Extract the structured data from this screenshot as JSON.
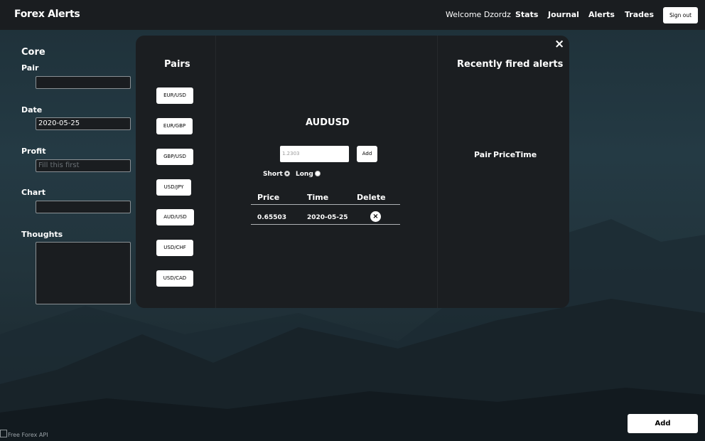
{
  "nav": {
    "brand": "Forex Alerts",
    "welcome": "Welcome Dzordz",
    "links": [
      "Stats",
      "Journal",
      "Alerts",
      "Trades"
    ],
    "signout": "Sign out"
  },
  "form": {
    "title": "Core",
    "pair_label": "Pair",
    "pair_value": "",
    "date_label": "Date",
    "date_value": "2020-05-25",
    "profit_label": "Profit",
    "profit_placeholder": "Fill this first",
    "chart_label": "Chart",
    "chart_value": "",
    "thoughts_label": "Thoughts",
    "thoughts_value": ""
  },
  "modal": {
    "close_icon": "×",
    "pairs_title": "Pairs",
    "pairs": [
      "EUR/USD",
      "EUR/GBP",
      "GBP/USD",
      "USD/JPY",
      "AUD/USD",
      "USD/CHF",
      "USD/CAD"
    ],
    "alert": {
      "pair": "AUDUSD",
      "price_placeholder": "1.2303",
      "add_label": "Add",
      "short_label": "Short",
      "long_label": "Long",
      "selected_direction": "Short",
      "columns": [
        "Price",
        "Time",
        "Delete"
      ],
      "rows": [
        {
          "price": "0.65503",
          "time": "2020-05-25"
        }
      ],
      "delete_icon": "×"
    },
    "recent": {
      "title": "Recently fired alerts",
      "columns": [
        "Pair",
        "Price",
        "Time"
      ]
    }
  },
  "footer": {
    "add_label": "Add",
    "api_alt": "Free Forex API"
  }
}
